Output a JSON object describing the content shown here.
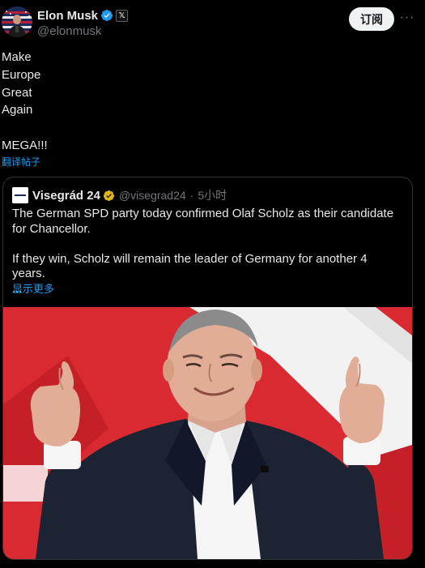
{
  "author": {
    "display_name": "Elon Musk",
    "handle": "@elonmusk",
    "affiliate_badge": "𝕏",
    "avatar_icon": "avatar-photo"
  },
  "actions": {
    "subscribe_label": "订阅",
    "more_label": "···"
  },
  "post": {
    "text": "Make\nEurope\nGreat\nAgain\n\nMEGA!!!",
    "translate_label": "翻译帖子"
  },
  "quote": {
    "display_name": "Visegrád 24",
    "handle": "@visegrad24",
    "separator": "·",
    "time": "5小时",
    "text": "The German SPD party today confirmed Olaf Scholz as their candidate for Chancellor.\n\nIf they win, Scholz will remain the leader of Germany for another 4 years.\n...",
    "show_more_label": "显示更多",
    "image_icon": "photo-of-man-giving-thumbs-up"
  },
  "colors": {
    "background": "#000000",
    "text": "#e7e9ea",
    "secondary": "#71767b",
    "link": "#1d9bf0",
    "verified_blue": "#1d9bf0",
    "verified_gold": "#e2b719",
    "card_border": "#2f3336",
    "photo_red": "#d92a31"
  }
}
